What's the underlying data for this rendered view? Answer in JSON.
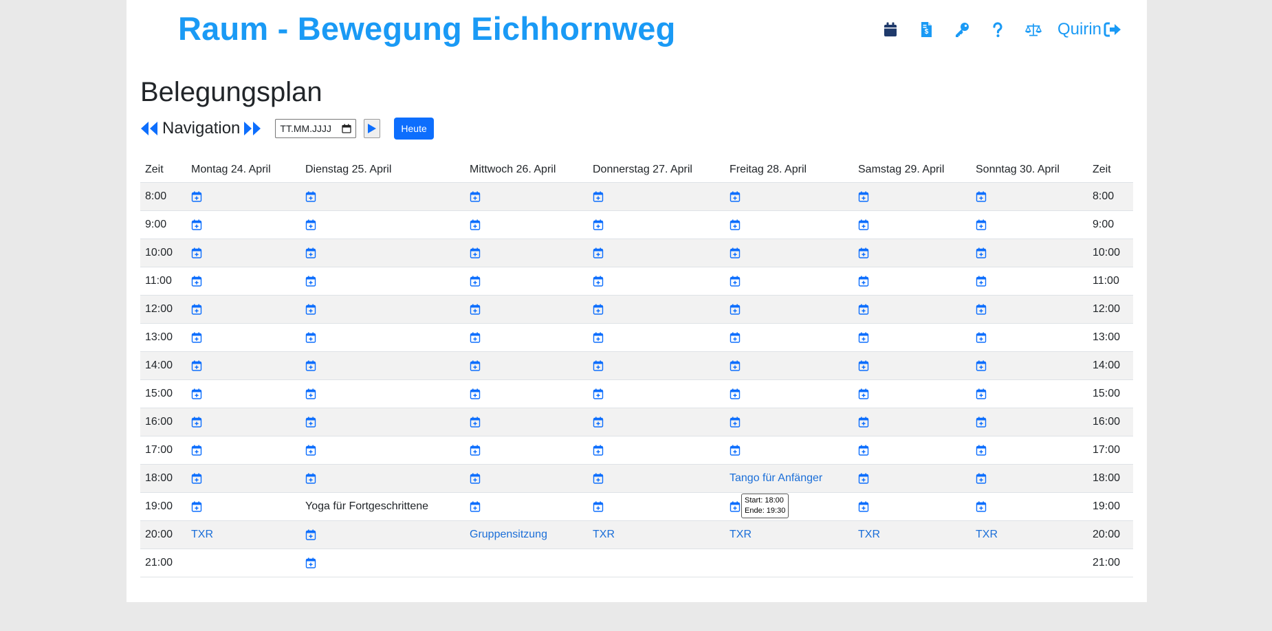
{
  "brand": "Raum - Bewegung Eichhornweg",
  "nav": {
    "icons": [
      "calendar-icon",
      "invoice-icon",
      "key-icon",
      "question-icon",
      "scale-icon"
    ],
    "user": "Quirin"
  },
  "page_title": "Belegungsplan",
  "navigation": {
    "label": "Navigation",
    "date_placeholder": "TT.MM.JJJJ",
    "today_button": "Heute"
  },
  "colors": {
    "brand": "#1a9af5",
    "accent": "#0d6efd",
    "link": "#1a6ed8",
    "dark_icon": "#1f3a6b"
  },
  "table": {
    "time_header": "Zeit",
    "days": [
      "Montag 24. April",
      "Dienstag 25. April",
      "Mittwoch 26. April",
      "Donnerstag 27. April",
      "Freitag 28. April",
      "Samstag 29. April",
      "Sonntag 30. April"
    ],
    "rows": [
      {
        "time": "8:00",
        "cells": [
          {
            "t": "add"
          },
          {
            "t": "add"
          },
          {
            "t": "add"
          },
          {
            "t": "add"
          },
          {
            "t": "add"
          },
          {
            "t": "add"
          },
          {
            "t": "add"
          }
        ]
      },
      {
        "time": "9:00",
        "cells": [
          {
            "t": "add"
          },
          {
            "t": "add"
          },
          {
            "t": "add"
          },
          {
            "t": "add"
          },
          {
            "t": "add"
          },
          {
            "t": "add"
          },
          {
            "t": "add"
          }
        ]
      },
      {
        "time": "10:00",
        "cells": [
          {
            "t": "add"
          },
          {
            "t": "add"
          },
          {
            "t": "add"
          },
          {
            "t": "add"
          },
          {
            "t": "add"
          },
          {
            "t": "add"
          },
          {
            "t": "add"
          }
        ]
      },
      {
        "time": "11:00",
        "cells": [
          {
            "t": "add"
          },
          {
            "t": "add"
          },
          {
            "t": "add"
          },
          {
            "t": "add"
          },
          {
            "t": "add"
          },
          {
            "t": "add"
          },
          {
            "t": "add"
          }
        ]
      },
      {
        "time": "12:00",
        "cells": [
          {
            "t": "add"
          },
          {
            "t": "add"
          },
          {
            "t": "add"
          },
          {
            "t": "add"
          },
          {
            "t": "add"
          },
          {
            "t": "add"
          },
          {
            "t": "add"
          }
        ]
      },
      {
        "time": "13:00",
        "cells": [
          {
            "t": "add"
          },
          {
            "t": "add"
          },
          {
            "t": "add"
          },
          {
            "t": "add"
          },
          {
            "t": "add"
          },
          {
            "t": "add"
          },
          {
            "t": "add"
          }
        ]
      },
      {
        "time": "14:00",
        "cells": [
          {
            "t": "add"
          },
          {
            "t": "add"
          },
          {
            "t": "add"
          },
          {
            "t": "add"
          },
          {
            "t": "add"
          },
          {
            "t": "add"
          },
          {
            "t": "add"
          }
        ]
      },
      {
        "time": "15:00",
        "cells": [
          {
            "t": "add"
          },
          {
            "t": "add"
          },
          {
            "t": "add"
          },
          {
            "t": "add"
          },
          {
            "t": "add"
          },
          {
            "t": "add"
          },
          {
            "t": "add"
          }
        ]
      },
      {
        "time": "16:00",
        "cells": [
          {
            "t": "add"
          },
          {
            "t": "add"
          },
          {
            "t": "add"
          },
          {
            "t": "add"
          },
          {
            "t": "add"
          },
          {
            "t": "add"
          },
          {
            "t": "add"
          }
        ]
      },
      {
        "time": "17:00",
        "cells": [
          {
            "t": "add"
          },
          {
            "t": "add"
          },
          {
            "t": "add"
          },
          {
            "t": "add"
          },
          {
            "t": "add"
          },
          {
            "t": "add"
          },
          {
            "t": "add"
          }
        ]
      },
      {
        "time": "18:00",
        "cells": [
          {
            "t": "add"
          },
          {
            "t": "add"
          },
          {
            "t": "add"
          },
          {
            "t": "add"
          },
          {
            "t": "link",
            "text": "Tango für Anfänger"
          },
          {
            "t": "add"
          },
          {
            "t": "add"
          }
        ]
      },
      {
        "time": "19:00",
        "cells": [
          {
            "t": "add"
          },
          {
            "t": "text",
            "text": "Yoga für Fortgeschrittene"
          },
          {
            "t": "add"
          },
          {
            "t": "add"
          },
          {
            "t": "add",
            "tip": [
              "Start: 18:00",
              "Ende: 19:30"
            ]
          },
          {
            "t": "add"
          },
          {
            "t": "add"
          }
        ]
      },
      {
        "time": "20:00",
        "cells": [
          {
            "t": "link",
            "text": "TXR"
          },
          {
            "t": "add"
          },
          {
            "t": "link",
            "text": "Gruppensitzung"
          },
          {
            "t": "link",
            "text": "TXR"
          },
          {
            "t": "link",
            "text": "TXR"
          },
          {
            "t": "link",
            "text": "TXR"
          },
          {
            "t": "link",
            "text": "TXR"
          }
        ]
      },
      {
        "time": "21:00",
        "cells": [
          {
            "t": "empty"
          },
          {
            "t": "add"
          },
          {
            "t": "empty"
          },
          {
            "t": "empty"
          },
          {
            "t": "empty"
          },
          {
            "t": "empty"
          },
          {
            "t": "empty"
          }
        ]
      }
    ]
  }
}
